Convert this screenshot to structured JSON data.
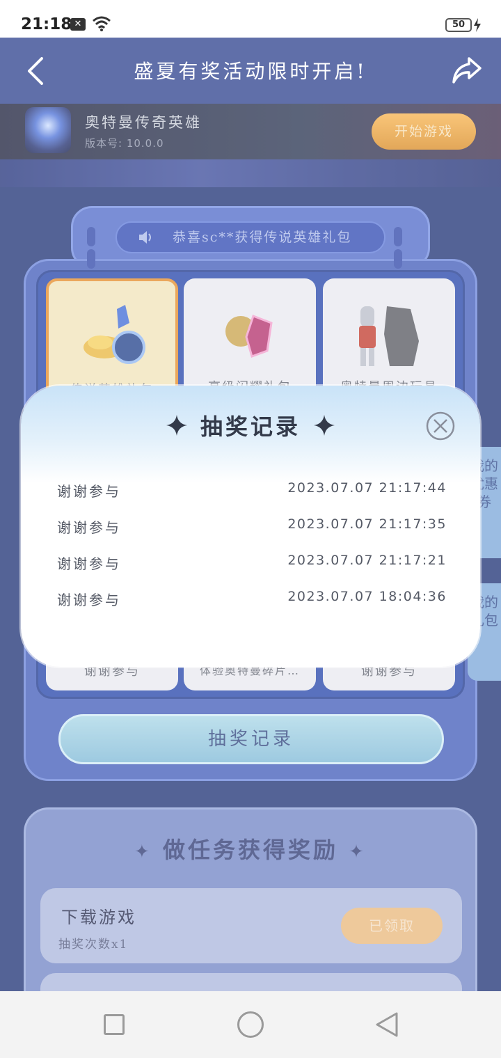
{
  "status_bar": {
    "time": "21:18",
    "battery": "50"
  },
  "header": {
    "title": "盛夏有奖活动限时开启!"
  },
  "game": {
    "name": "奥特曼传奇英雄",
    "version": "版本号: 10.0.0",
    "start_label": "开始游戏"
  },
  "ticker": {
    "text": "恭喜sc**获得传说英雄礼包"
  },
  "prizes": [
    {
      "label": "传说英雄礼包"
    },
    {
      "label": "高级闪耀礼包"
    },
    {
      "label": "奥特曼周边玩具"
    }
  ],
  "prizes_bottom": [
    {
      "label": "谢谢参与"
    },
    {
      "label": "体验奥特曼碎片…"
    },
    {
      "label": "谢谢参与"
    }
  ],
  "record_button_label": "抽奖记录",
  "side_tabs": {
    "coupons": "我的优惠券",
    "gifts": "我的礼包"
  },
  "tasks": {
    "title": "做任务获得奖励",
    "items": [
      {
        "name": "下载游戏",
        "sub": "抽奖次数x1",
        "button": "已领取"
      }
    ]
  },
  "modal": {
    "title": "抽奖记录",
    "records": [
      {
        "result": "谢谢参与",
        "time": "2023.07.07 21:17:44"
      },
      {
        "result": "谢谢参与",
        "time": "2023.07.07 21:17:35"
      },
      {
        "result": "谢谢参与",
        "time": "2023.07.07 21:17:21"
      },
      {
        "result": "谢谢参与",
        "time": "2023.07.07 18:04:36"
      }
    ]
  },
  "colors": {
    "header": "#2b3f8c",
    "accent": "#e48a26",
    "modal_top": "#c9e3f8"
  }
}
